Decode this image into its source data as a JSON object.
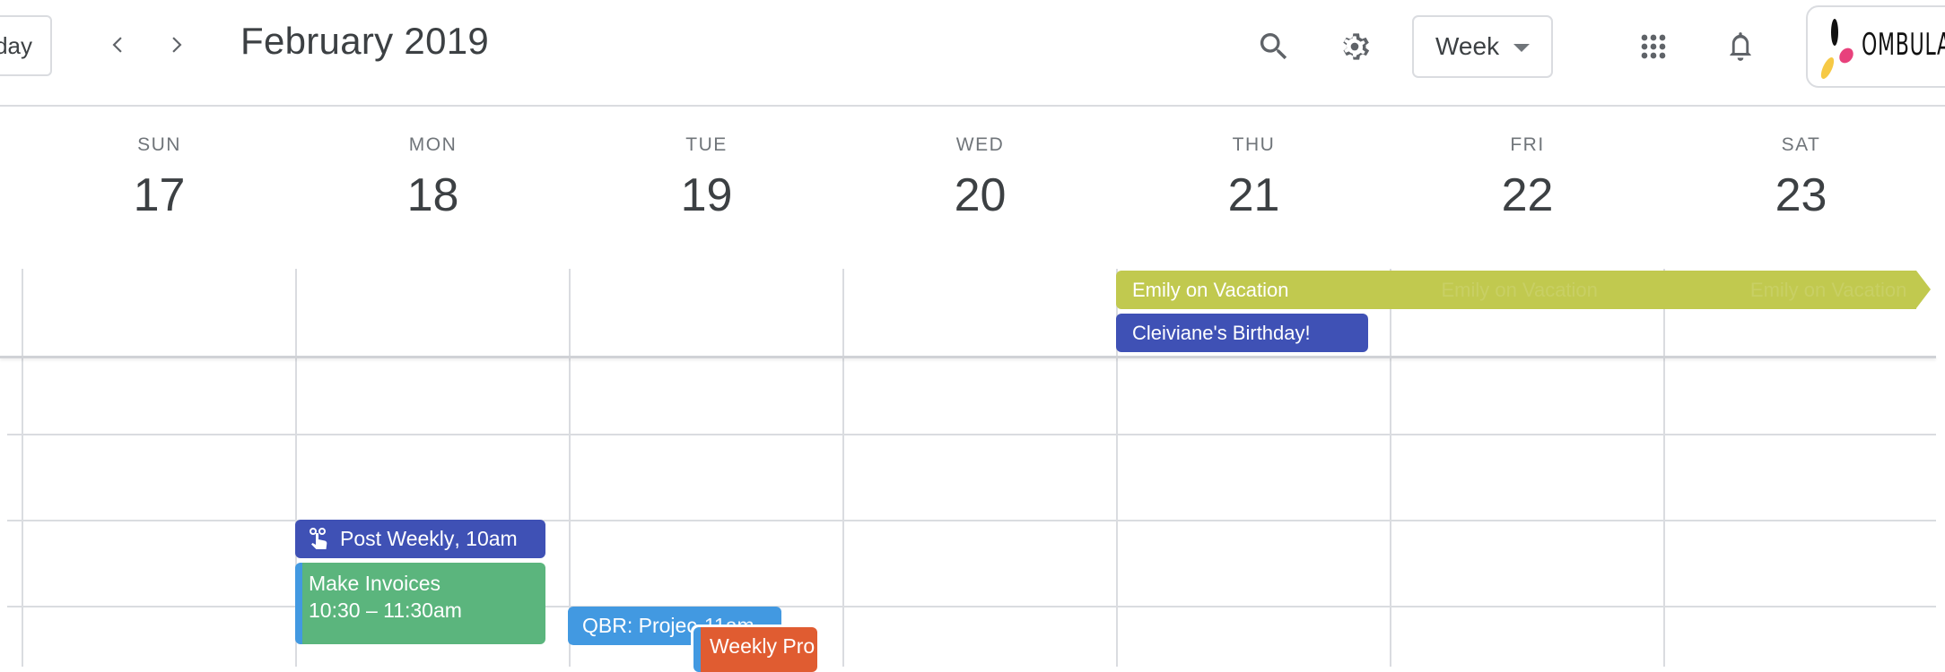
{
  "header": {
    "today_label": "Today",
    "prev_icon": "chevron-left-icon",
    "next_icon": "chevron-right-icon",
    "month_title": "February 2019",
    "search_icon": "search-icon",
    "settings_icon": "gear-icon",
    "view_select": {
      "selected": "Week"
    },
    "apps_icon": "apps-grid-icon",
    "notifications_icon": "bell-icon",
    "logo_text": "OMBULABS"
  },
  "days": [
    {
      "name": "SUN",
      "number": "17"
    },
    {
      "name": "MON",
      "number": "18"
    },
    {
      "name": "TUE",
      "number": "19"
    },
    {
      "name": "WED",
      "number": "20"
    },
    {
      "name": "THU",
      "number": "21"
    },
    {
      "name": "FRI",
      "number": "22"
    },
    {
      "name": "SAT",
      "number": "23"
    }
  ],
  "all_day_events": [
    {
      "title": "Emily on Vacation",
      "start_day": "THU",
      "continues": true,
      "color": "#c1c94f"
    },
    {
      "title": "Cleiviane's Birthday!",
      "start_day": "THU",
      "color": "#3f51b5"
    }
  ],
  "timed_events": [
    {
      "title": "Post Weekly",
      "time": ", 10am",
      "day": "MON",
      "icon": "touch-hand-icon",
      "color": "#3f51b5"
    },
    {
      "title": "Make Invoices",
      "time": "10:30 – 11:30am",
      "day": "MON",
      "color": "#5bb57d",
      "accent": "#4299e1"
    },
    {
      "title": "QBR: Projec",
      "time": "11am",
      "day": "TUE",
      "color": "#4299e1"
    },
    {
      "title": "Weekly Pro",
      "day": "TUE",
      "color": "#e05c31",
      "accent": "#4299e1"
    }
  ]
}
